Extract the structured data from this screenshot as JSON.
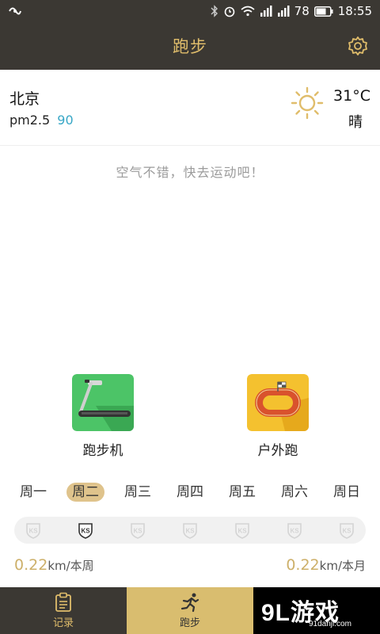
{
  "status_bar": {
    "battery": "78",
    "time": "18:55"
  },
  "header": {
    "title": "跑步"
  },
  "weather": {
    "city": "北京",
    "pm_label": "pm2.5",
    "pm_value": "90",
    "temperature": "31°C",
    "condition": "晴"
  },
  "message": "空气不错，快去运动吧！",
  "modes": {
    "treadmill_label": "跑步机",
    "outdoor_label": "户外跑"
  },
  "week": {
    "days": [
      "周一",
      "周二",
      "周三",
      "周四",
      "周五",
      "周六",
      "周日"
    ],
    "selected": "周二",
    "badge_text": "KS"
  },
  "stats": {
    "week_value": "0.22",
    "week_unit": "km/本周",
    "month_value": "0.22",
    "month_unit": "km/本月"
  },
  "bottom_nav": {
    "record_label": "记录",
    "run_label": "跑步"
  },
  "watermark": {
    "main": "9L游戏",
    "sub": "91danji.com"
  },
  "colors": {
    "accent": "#e0bd6b",
    "dark": "#3b3833",
    "pm_value": "#38a7c6",
    "active_day": "#dfc38c"
  }
}
